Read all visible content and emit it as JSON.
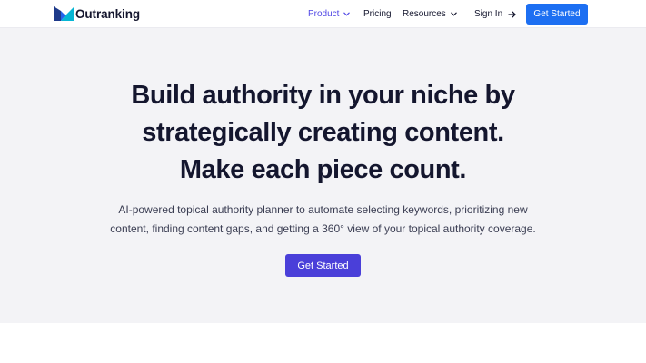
{
  "brand": {
    "name": "Outranking",
    "colors": {
      "logo_left": "#1e40af",
      "logo_right": "#06b6d4"
    }
  },
  "nav": {
    "items": [
      {
        "label": "Product",
        "active": true,
        "has_dropdown": true
      },
      {
        "label": "Pricing",
        "active": false,
        "has_dropdown": false
      },
      {
        "label": "Resources",
        "active": false,
        "has_dropdown": true
      }
    ],
    "signin_label": "Sign In",
    "signin_icon": "arrow-right-icon",
    "cta_label": "Get Started"
  },
  "hero": {
    "headline_lines": [
      "Build authority in your niche by",
      "strategically creating content.",
      "Make each piece count."
    ],
    "subtext_lines": [
      "AI-powered topical authority planner to automate selecting keywords, prioritizing new",
      "content, finding content gaps, and getting a 360° view of your topical authority coverage."
    ],
    "cta_label": "Get Started"
  },
  "colors": {
    "accent_nav": "#4f46e5",
    "header_button": "#1d6ff2",
    "hero_button": "#4a3fd9",
    "hero_background": "#f3f3f6",
    "text_dark": "#14162e"
  }
}
